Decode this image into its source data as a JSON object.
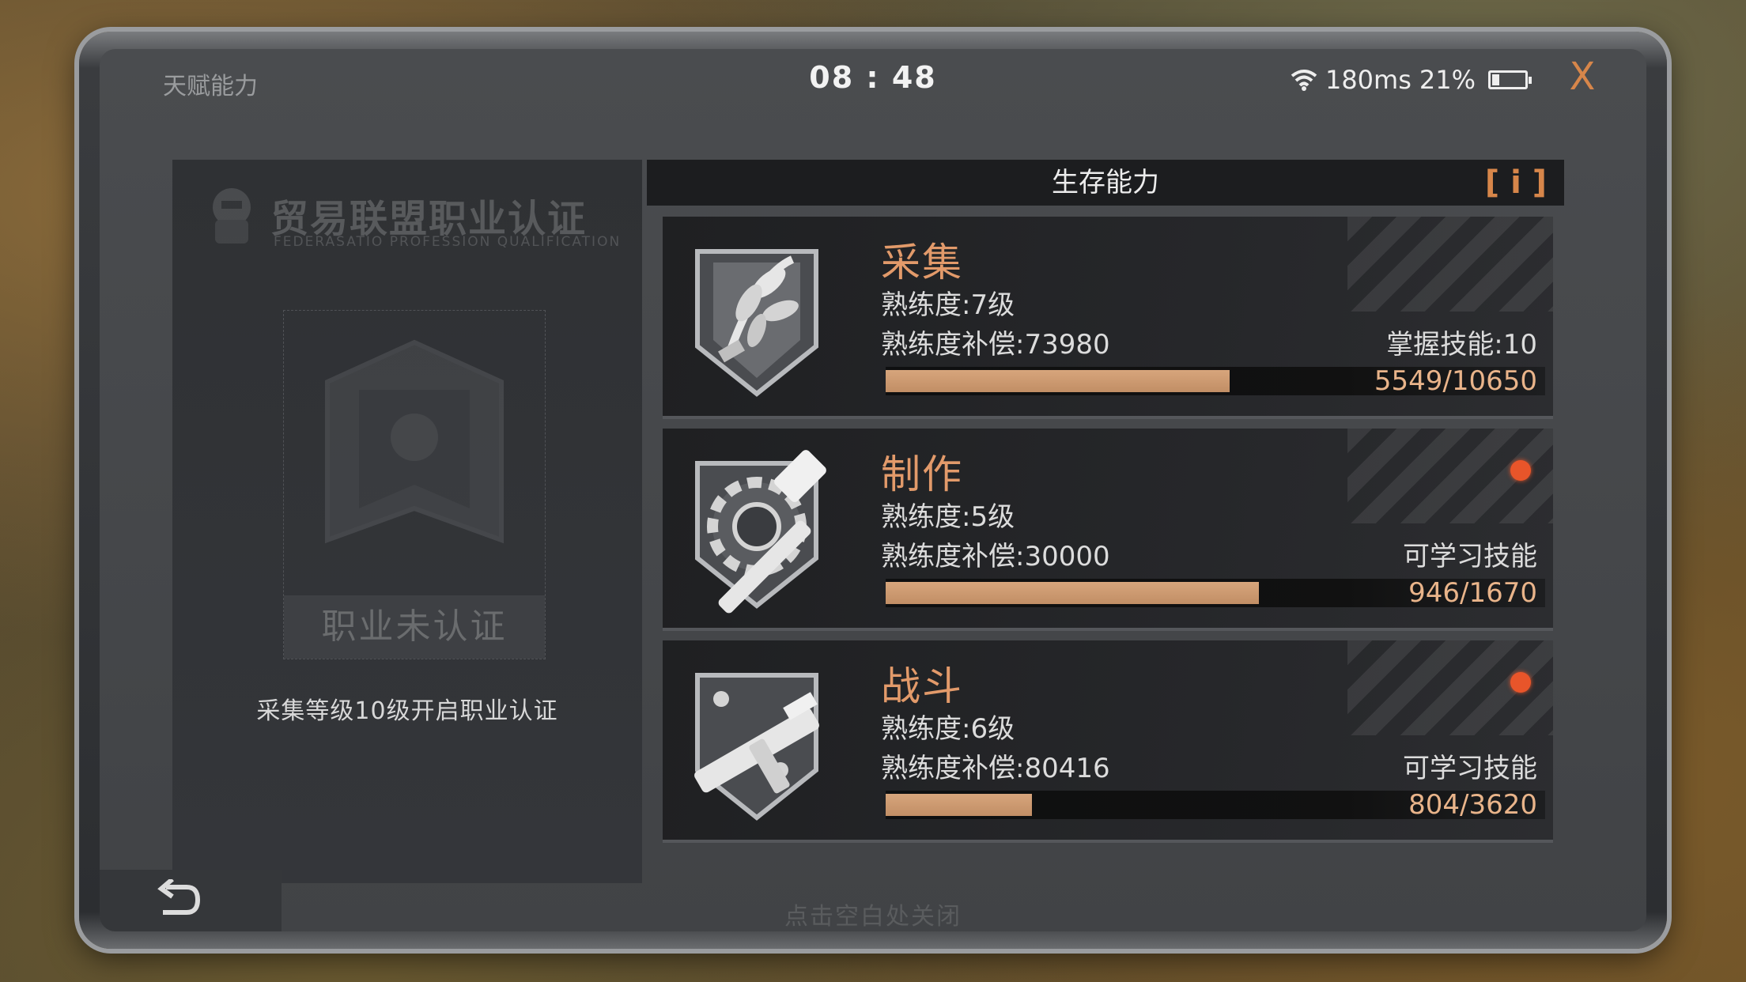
{
  "header": {
    "title": "天赋能力",
    "time": "08 : 48",
    "ping": "180ms",
    "battery": "21%",
    "battery_level": 0.21,
    "close_label": "X"
  },
  "left_panel": {
    "cert_title": "贸易联盟职业认证",
    "cert_subtitle": "FEDERASATIO PROFESSION QUALIFICATION",
    "status_button": "职业未认证",
    "unlock_hint": "采集等级10级开启职业认证"
  },
  "right_panel": {
    "title": "生存能力",
    "info_label": "[ i ]"
  },
  "skills": [
    {
      "name": "采集",
      "level": "熟练度:7级",
      "compensation": "熟练度补偿:73980",
      "right_text": "掌握技能:10",
      "progress_text": "5549/10650",
      "progress": 0.521,
      "has_alert": false,
      "icon": "leaf-bundle-icon"
    },
    {
      "name": "制作",
      "level": "熟练度:5级",
      "compensation": "熟练度补偿:30000",
      "right_text": "可学习技能",
      "progress_text": "946/1670",
      "progress": 0.566,
      "has_alert": true,
      "icon": "gear-hammer-icon"
    },
    {
      "name": "战斗",
      "level": "熟练度:6级",
      "compensation": "熟练度补偿:80416",
      "right_text": "可学习技能",
      "progress_text": "804/3620",
      "progress": 0.222,
      "has_alert": true,
      "icon": "submachine-gun-icon"
    }
  ],
  "footer": {
    "hint": "点击空白处关闭"
  },
  "colors": {
    "accent": "#d7864a",
    "bar_fill": "#c99a73",
    "alert": "#e8552a"
  }
}
